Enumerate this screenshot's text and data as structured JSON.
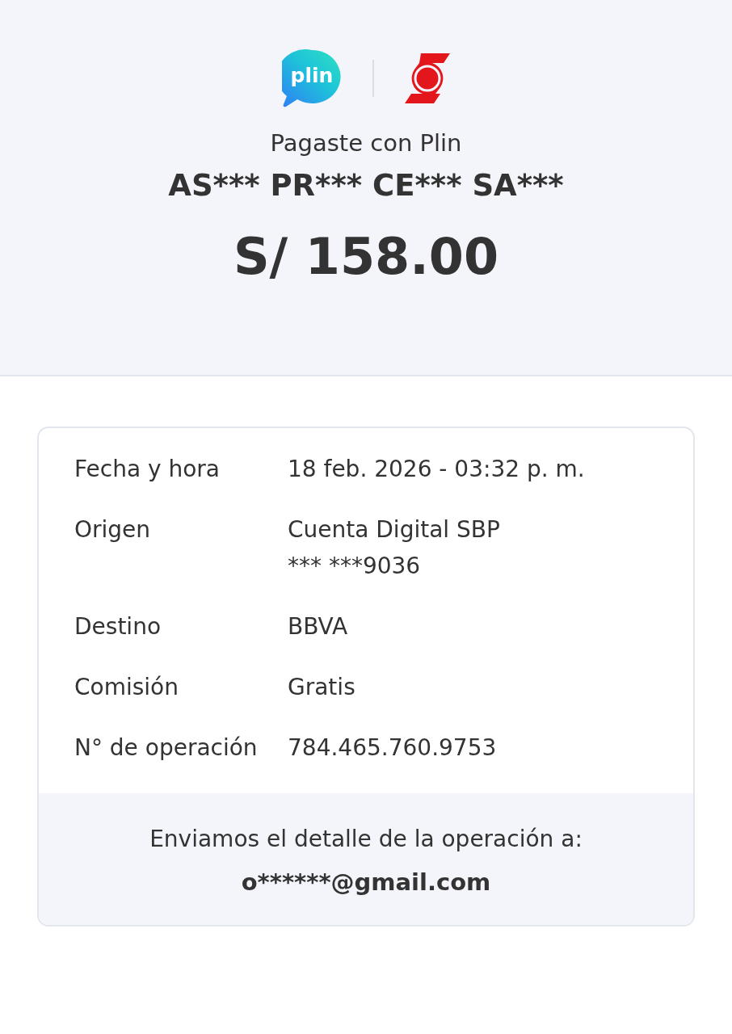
{
  "header": {
    "logo_text": "plin",
    "subtitle": "Pagaste con Plin",
    "recipient": "AS*** PR*** CE*** SA***",
    "amount": "S/ 158.00"
  },
  "details": [
    {
      "label": "Fecha y hora",
      "value": [
        "18 feb. 2026 - 03:32 p. m."
      ]
    },
    {
      "label": "Origen",
      "value": [
        "Cuenta Digital SBP",
        "*** ***9036"
      ]
    },
    {
      "label": "Destino",
      "value": [
        "BBVA"
      ]
    },
    {
      "label": "Comisión",
      "value": [
        "Gratis"
      ]
    },
    {
      "label": "N° de operación",
      "value": [
        "784.465.760.9753"
      ]
    }
  ],
  "footer": {
    "message": "Enviamos el detalle de la operación a:",
    "email": "o******@gmail.com"
  }
}
